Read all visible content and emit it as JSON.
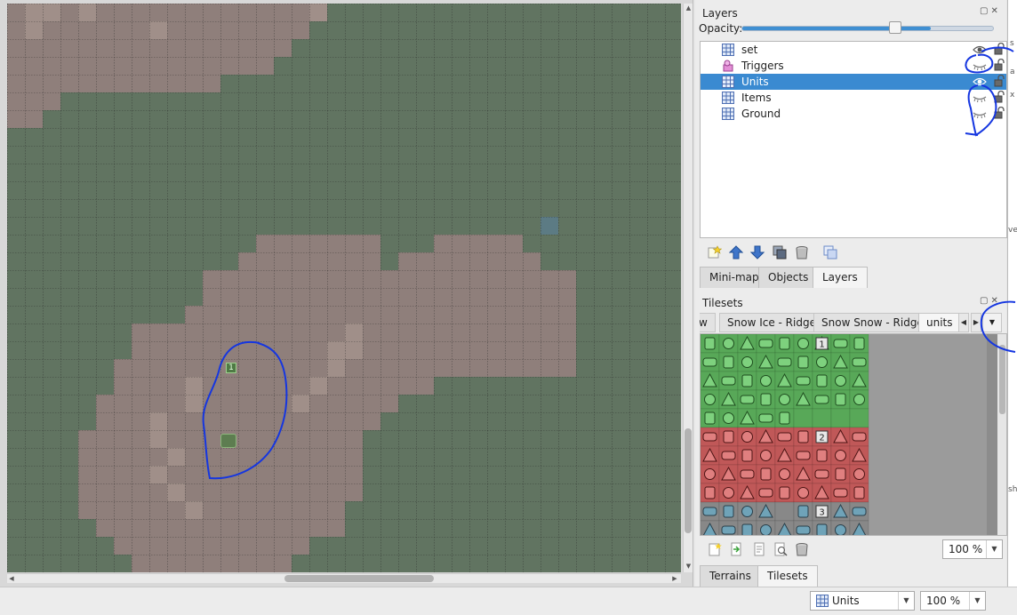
{
  "layers_panel": {
    "title": "Layers",
    "opacity_label": "Opacity:",
    "opacity_value": 0.75,
    "layers": [
      {
        "name": "set",
        "type": "tile",
        "visible": true,
        "selected": false
      },
      {
        "name": "Triggers",
        "type": "object",
        "visible": false,
        "selected": false
      },
      {
        "name": "Units",
        "type": "tile",
        "visible": true,
        "selected": true
      },
      {
        "name": "Items",
        "type": "tile",
        "visible": false,
        "selected": false
      },
      {
        "name": "Ground",
        "type": "tile",
        "visible": false,
        "selected": false
      }
    ],
    "toolbar_icons": [
      "add-layer-icon",
      "move-up-icon",
      "move-down-icon",
      "duplicate-layer-icon",
      "delete-layer-icon",
      "layer-properties-icon"
    ]
  },
  "dock_tabs_top": {
    "tabs": [
      "Mini-map",
      "Objects",
      "Layers"
    ],
    "active": "Layers"
  },
  "tilesets_panel": {
    "title": "Tilesets",
    "tabs": [
      "w",
      "Snow Ice - Ridge",
      "Snow Snow - Ridge",
      "units"
    ],
    "active_tab": "units",
    "zoom_value": "100 %",
    "toolbar_icons": [
      "new-tileset-icon",
      "import-tileset-icon",
      "export-tileset-icon",
      "tileset-properties-icon",
      "delete-tileset-icon"
    ],
    "group_labels": [
      "1",
      "2",
      "3"
    ]
  },
  "dock_tabs_bottom": {
    "tabs": [
      "Terrains",
      "Tilesets"
    ],
    "active": "Tilesets"
  },
  "statusbar": {
    "layer_combo_value": "Units",
    "zoom_combo_value": "100 %"
  },
  "map": {
    "unit_marker_label": "1"
  },
  "colors": {
    "grass": "#617461",
    "dirt": "#8f7f7b",
    "dirt_light": "#a08f89",
    "water": "#5c7b84",
    "selection": "#3a8ad1",
    "annotation": "#1536e0",
    "tileset_green": "#58a858",
    "tileset_red": "#c05858",
    "tileset_gray": "#888888"
  },
  "edge_text": [
    "s",
    "a",
    "x",
    "ve",
    "sh"
  ]
}
